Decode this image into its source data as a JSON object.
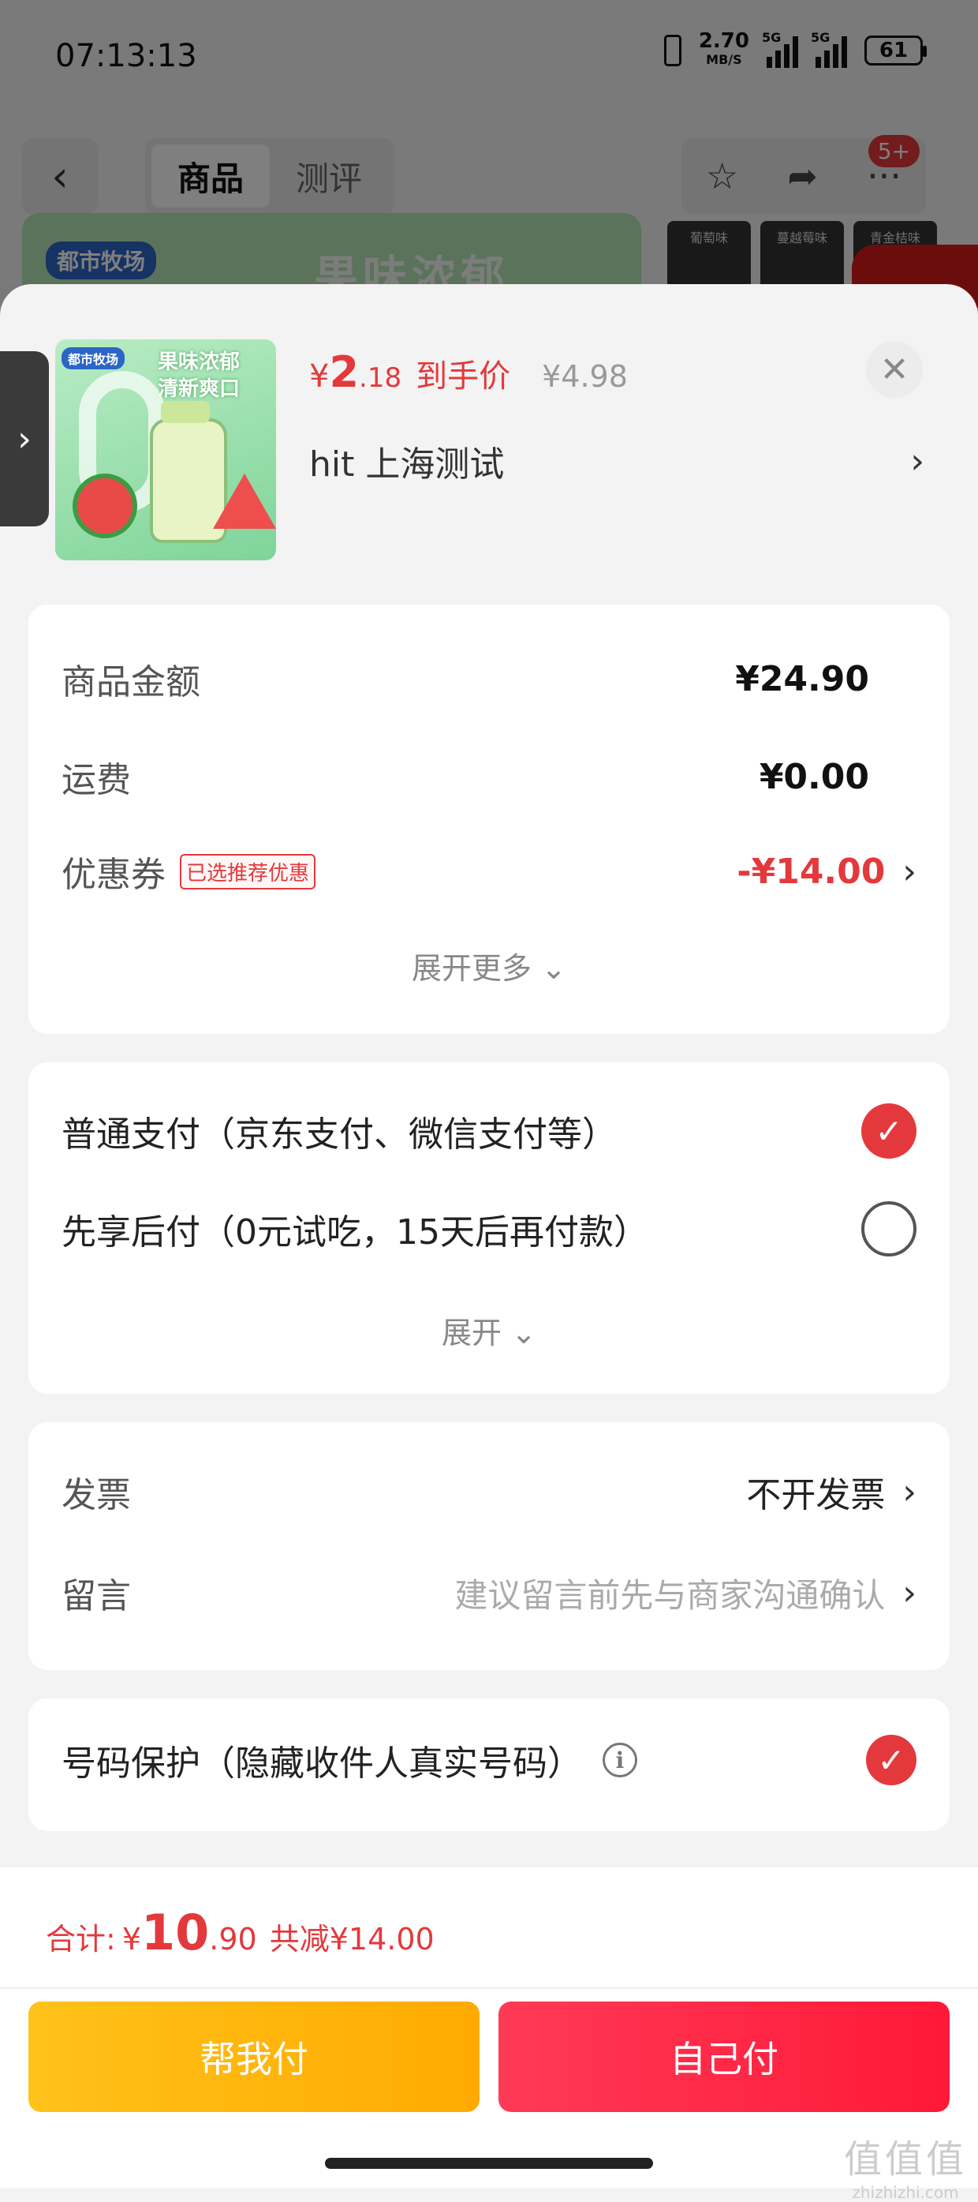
{
  "status_bar": {
    "time": "07:13:13",
    "net_speed": "2.70",
    "net_unit": "MB/S",
    "sig1_label": "5G",
    "sig2_label": "5G",
    "battery": "61"
  },
  "nav": {
    "back_icon": "chevron-left-icon",
    "tabs": [
      {
        "label": "商品",
        "active": true
      },
      {
        "label": "测评",
        "active": false
      }
    ],
    "icons": [
      "star-icon",
      "share-icon",
      "more-icon"
    ],
    "badge": "5+"
  },
  "banner": {
    "logo": "都市牧场",
    "text": "果味浓郁",
    "thumbs": [
      "葡萄味",
      "蔓越莓味",
      "青金桔味"
    ]
  },
  "product": {
    "image_logo": "都市牧场",
    "image_text1": "果味浓郁",
    "image_text2": "清新爽口",
    "price_currency": "¥",
    "price_int": "2",
    "price_dec": ".18",
    "price_label": "到手价",
    "original_price": "¥4.98",
    "address": "hit  上海测试"
  },
  "summary": {
    "goods_amount_label": "商品金额",
    "goods_amount": "¥24.90",
    "shipping_label": "运费",
    "shipping": "¥0.00",
    "coupon_label": "优惠券",
    "coupon_badge": "已选推荐优惠",
    "coupon_value": "-¥14.00",
    "expand_more": "展开更多"
  },
  "payment": {
    "options": [
      {
        "label": "普通支付（京东支付、微信支付等）",
        "selected": true
      },
      {
        "label": "先享后付（0元试吃，15天后再付款）",
        "selected": false
      }
    ],
    "expand": "展开"
  },
  "invoice": {
    "invoice_label": "发票",
    "invoice_value": "不开发票",
    "message_label": "留言",
    "message_placeholder": "建议留言前先与商家沟通确认"
  },
  "privacy": {
    "label": "号码保护（隐藏收件人真实号码）",
    "checked": true
  },
  "footer": {
    "total_label": "合计:",
    "total_currency": "¥",
    "total_int": "10",
    "total_dec": ".90",
    "total_save": "共减¥14.00",
    "help_pay": "帮我付",
    "self_pay": "自己付"
  },
  "watermark": {
    "mark": "值值值",
    "url": "zhizhizhi.com"
  },
  "colors": {
    "accent": "#e4393c",
    "help_btn": "#ffb300",
    "self_btn": "#ff2a47"
  }
}
